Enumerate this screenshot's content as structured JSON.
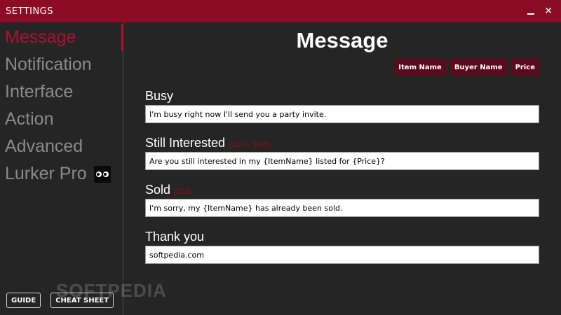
{
  "window": {
    "title": "SETTINGS",
    "minimize_glyph": "_",
    "close_glyph": "✕"
  },
  "sidebar": {
    "items": [
      {
        "label": "Message"
      },
      {
        "label": "Notification"
      },
      {
        "label": "Interface"
      },
      {
        "label": "Action"
      },
      {
        "label": "Advanced"
      },
      {
        "label": "Lurker Pro"
      }
    ],
    "active_index": 0,
    "guide_label": "GUIDE",
    "cheat_sheet_label": "CHEAT SHEET"
  },
  "main": {
    "title": "Message",
    "tags": [
      "Item Name",
      "Buyer Name",
      "Price"
    ],
    "fields": [
      {
        "label": "Busy",
        "hint": "",
        "value": "I'm busy right now I'll send you a party invite."
      },
      {
        "label": "Still Interested",
        "hint": "(Ctrl + Shift)",
        "value": "Are you still interested in my {ItemName} listed for {Price}?"
      },
      {
        "label": "Sold",
        "hint": "(Ctrl)",
        "value": "I'm sorry, my {ItemName} has already been sold."
      },
      {
        "label": "Thank you",
        "hint": "",
        "value": "softpedia.com"
      }
    ]
  },
  "watermark": "SOFTPEDIA",
  "colors": {
    "accent": "#8c0b25",
    "active_nav": "#b01030",
    "tag_bg": "#5a0a1c",
    "background": "#252525"
  }
}
